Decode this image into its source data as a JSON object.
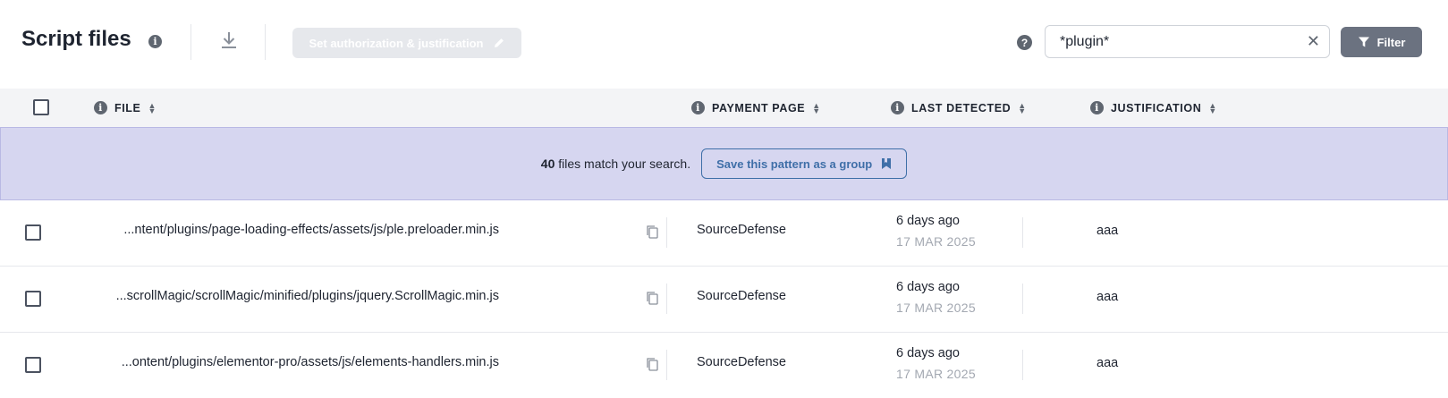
{
  "toolbar": {
    "title": "Script files",
    "auth_button_label": "Set authorization & justification",
    "search_value": "*plugin*",
    "filter_label": "Filter"
  },
  "table": {
    "columns": [
      "FILE",
      "PAYMENT PAGE",
      "LAST DETECTED",
      "JUSTIFICATION"
    ],
    "rows": [
      {
        "file": "...ntent/plugins/page-loading-effects/assets/js/ple.preloader.min.js",
        "payment_page": "SourceDefense",
        "detected_relative": "6 days ago",
        "detected_date": "17 MAR 2025",
        "justification": "aaa"
      },
      {
        "file": "...scrollMagic/scrollMagic/minified/plugins/jquery.ScrollMagic.min.js",
        "payment_page": "SourceDefense",
        "detected_relative": "6 days ago",
        "detected_date": "17 MAR 2025",
        "justification": "aaa"
      },
      {
        "file": "...ontent/plugins/elementor-pro/assets/js/elements-handlers.min.js",
        "payment_page": "SourceDefense",
        "detected_relative": "6 days ago",
        "detected_date": "17 MAR 2025",
        "justification": "aaa"
      }
    ]
  },
  "banner": {
    "count": "40",
    "text": "files match your search.",
    "save_label": "Save this pattern as a group"
  },
  "icons": {
    "info": "info-icon",
    "download": "download-icon",
    "pencil": "pencil-icon",
    "help": "help-icon",
    "clear": "close-icon",
    "filter": "funnel-icon",
    "sort": "sort-icon",
    "copy": "copy-icon",
    "bookmark": "bookmark-icon"
  },
  "colors": {
    "banner_bg": "#d6d6f0",
    "accent": "#3f6fa8",
    "filter_bg": "#6b7280",
    "header_bg": "#f3f4f6"
  }
}
